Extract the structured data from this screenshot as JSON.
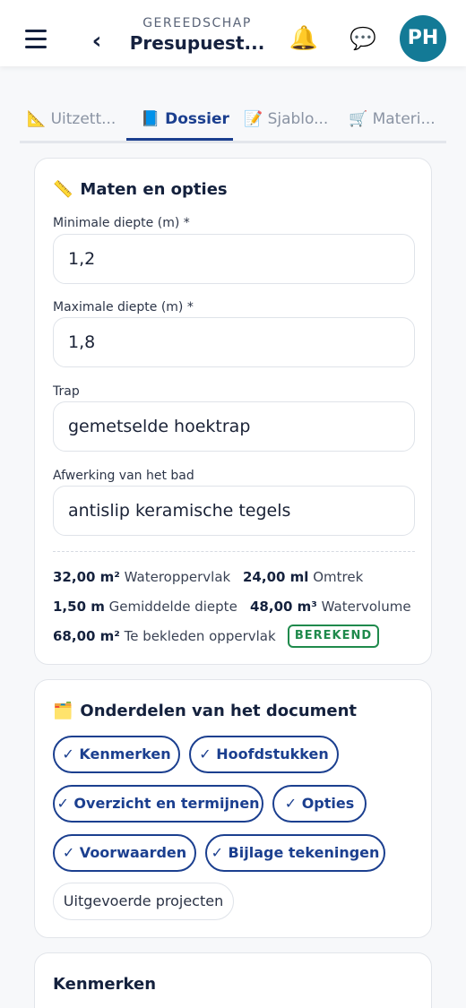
{
  "header": {
    "supertitle": "GEREEDSCHAP",
    "title": "Presupuest...",
    "avatar_initials": "PH",
    "back_glyph": "‹",
    "bell_glyph": "🔔",
    "chat_glyph": "💬"
  },
  "tabs": [
    {
      "icon": "📐",
      "label": "Uitzett...",
      "active": false
    },
    {
      "icon": "📘",
      "label": "Dossier",
      "active": true
    },
    {
      "icon": "📝",
      "label": "Sjablo...",
      "active": false
    },
    {
      "icon": "🛒",
      "label": "Materi...",
      "active": false
    }
  ],
  "dimensions": {
    "icon": "📏",
    "title": "Maten en opties",
    "fields": [
      {
        "label": "Minimale diepte (m) *",
        "value": "1,2"
      },
      {
        "label": "Maximale diepte (m) *",
        "value": "1,8"
      },
      {
        "label": "Trap",
        "value": "gemetselde hoektrap"
      },
      {
        "label": "Afwerking van het bad",
        "value": "antislip keramische tegels"
      }
    ],
    "stats": [
      {
        "value": "32,00 m²",
        "label": "Wateroppervlak"
      },
      {
        "value": "24,00 ml",
        "label": "Omtrek"
      },
      {
        "value": "1,50 m",
        "label": "Gemiddelde diepte"
      },
      {
        "value": "48,00 m³",
        "label": "Watervolume"
      },
      {
        "value": "68,00 m²",
        "label": "Te bekleden oppervlak"
      }
    ],
    "badge": "BEREKEND"
  },
  "sections": {
    "icon": "🗂️",
    "title": "Onderdelen van het document",
    "chips": [
      {
        "label": "✓ Kenmerken",
        "selected": true
      },
      {
        "label": "✓ Hoofdstukken",
        "selected": true
      },
      {
        "label": "✓ Overzicht en termijnen",
        "selected": true
      },
      {
        "label": "✓ Opties",
        "selected": true
      },
      {
        "label": "✓ Voorwaarden",
        "selected": true
      },
      {
        "label": "✓ Bijlage tekeningen",
        "selected": true
      },
      {
        "label": "Uitgevoerde projecten",
        "selected": false
      }
    ]
  },
  "features": {
    "title": "Kenmerken"
  }
}
